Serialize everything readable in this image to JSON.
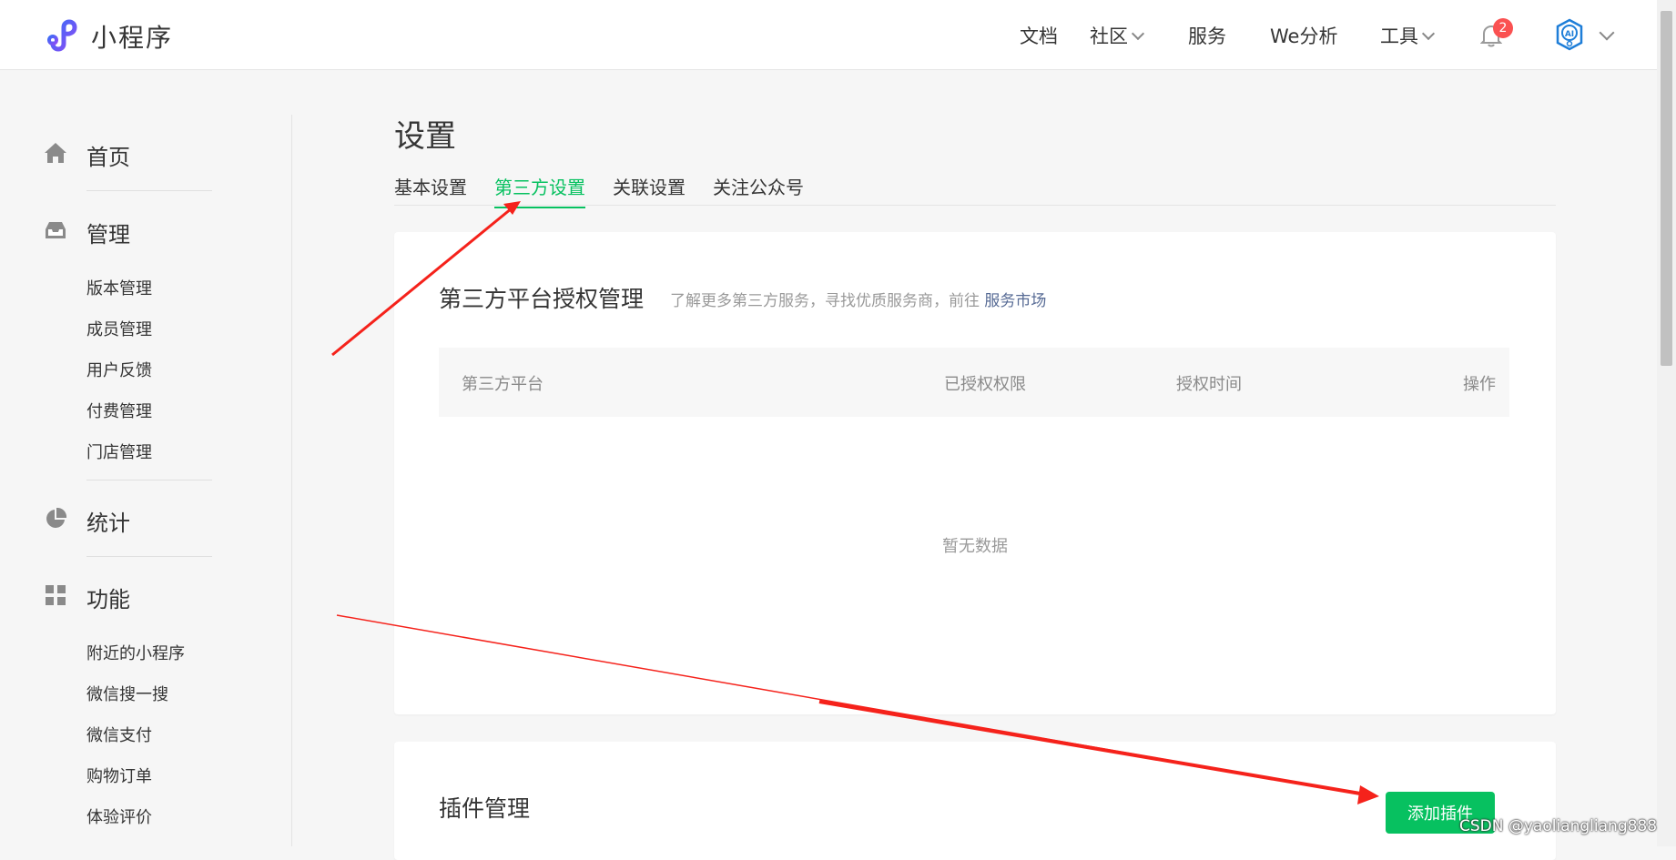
{
  "header": {
    "brand": "小程序",
    "nav": [
      {
        "label": "文档",
        "dropdown": false
      },
      {
        "label": "社区",
        "dropdown": true
      },
      {
        "label": "服务",
        "dropdown": false
      },
      {
        "label": "We分析",
        "dropdown": false
      },
      {
        "label": "工具",
        "dropdown": true
      }
    ],
    "notification_count": "2",
    "avatar_text": "AI"
  },
  "sidebar": {
    "sections": [
      {
        "icon": "home-icon",
        "label": "首页"
      },
      {
        "icon": "inbox-icon",
        "label": "管理",
        "items": [
          "版本管理",
          "成员管理",
          "用户反馈",
          "付费管理",
          "门店管理"
        ]
      },
      {
        "icon": "pie-chart-icon",
        "label": "统计"
      },
      {
        "icon": "grid-icon",
        "label": "功能",
        "items": [
          "附近的小程序",
          "微信搜一搜",
          "微信支付",
          "购物订单",
          "体验评价"
        ]
      }
    ]
  },
  "main": {
    "title": "设置",
    "tabs": [
      "基本设置",
      "第三方设置",
      "关联设置",
      "关注公众号"
    ],
    "active_tab": 1,
    "third_party": {
      "title": "第三方平台授权管理",
      "desc": "了解更多第三方服务，寻找优质服务商，前往",
      "link": "服务市场",
      "columns": [
        "第三方平台",
        "已授权权限",
        "授权时间",
        "操作"
      ],
      "empty": "暂无数据"
    },
    "plugins": {
      "title": "插件管理",
      "add_button": "添加插件"
    }
  },
  "watermark": "CSDN @yaoliangliang888",
  "colors": {
    "accent": "#07c160",
    "link": "#576b95",
    "annotation": "#f5221b",
    "badge": "#fa5151"
  }
}
